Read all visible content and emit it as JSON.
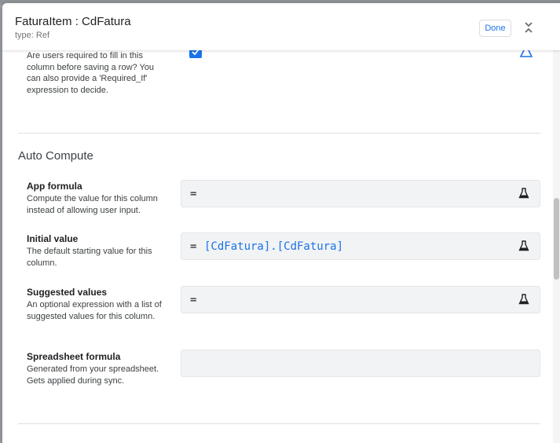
{
  "header": {
    "title": "FaturaItem : CdFatura",
    "type_label": "type: Ref",
    "done_label": "Done"
  },
  "required": {
    "description": "Are users required to fill in this column before saving a row? You can also provide a 'Required_If' expression to decide.",
    "checked": true
  },
  "auto_compute": {
    "section_title": "Auto Compute",
    "app_formula": {
      "label": "App formula",
      "description": "Compute the value for this column instead of allowing user input.",
      "prefix": "=",
      "value": ""
    },
    "initial_value": {
      "label": "Initial value",
      "description": "The default starting value for this column.",
      "prefix": "=",
      "value": "[CdFatura].[CdFatura]"
    },
    "suggested_values": {
      "label": "Suggested values",
      "description": "An optional expression with a list of suggested values for this column.",
      "prefix": "=",
      "value": ""
    },
    "spreadsheet_formula": {
      "label": "Spreadsheet formula",
      "description": "Generated from your spreadsheet. Gets applied during sync.",
      "value": ""
    }
  },
  "colors": {
    "accent": "#1a73e8",
    "field_bg": "#f1f3f4"
  }
}
